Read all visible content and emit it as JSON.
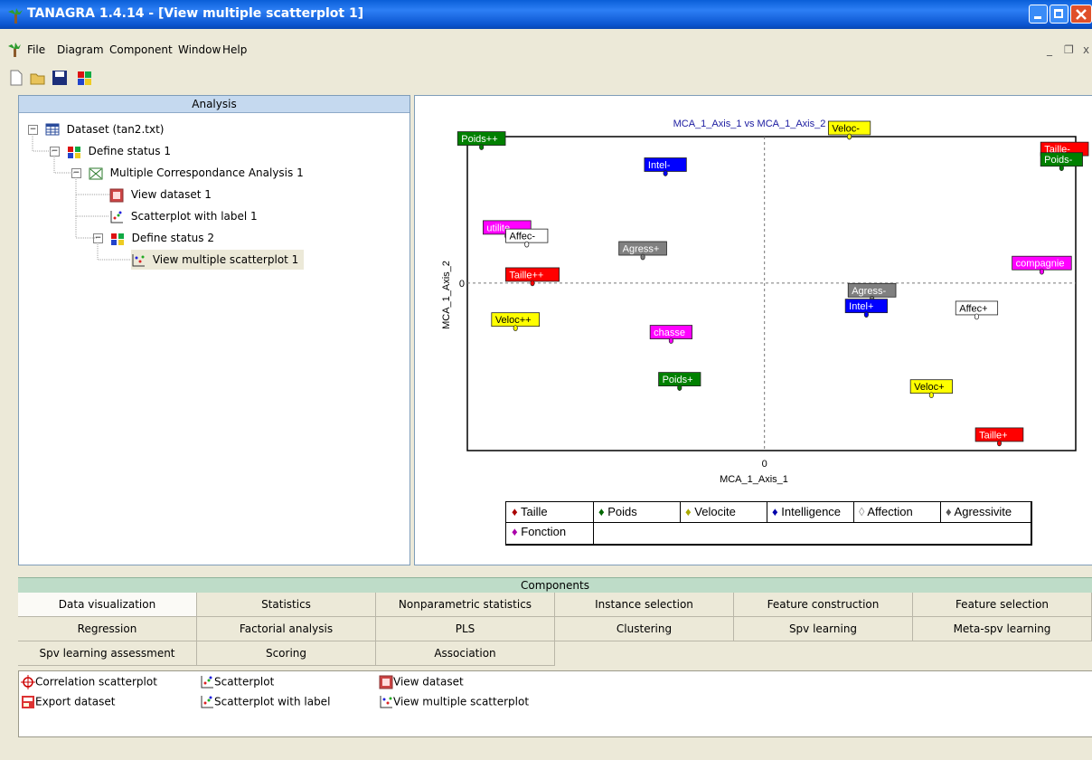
{
  "window": {
    "title": "TANAGRA 1.4.14 - [View multiple scatterplot 1]"
  },
  "menu": {
    "items": [
      "File",
      "Diagram",
      "Component",
      "Window",
      "Help"
    ]
  },
  "analysis": {
    "header": "Analysis",
    "tree": [
      "Dataset (tan2.txt)",
      "Define status 1",
      "Multiple Correspondance Analysis 1",
      "View dataset 1",
      "Scatterplot with label 1",
      "Define status 2",
      "View multiple scatterplot 1"
    ]
  },
  "chart_data": {
    "type": "scatter",
    "title": "MCA_1_Axis_1 vs MCA_1_Axis_2",
    "xlabel": "MCA_1_Axis_1",
    "ylabel": "MCA_1_Axis_2",
    "x_origin_label": "0",
    "y_origin_label": "0",
    "grid": "dashed zero lines",
    "legend_position": "bottom",
    "series": [
      {
        "name": "Taille",
        "color": "#ff0000"
      },
      {
        "name": "Poids",
        "color": "#008000"
      },
      {
        "name": "Velocite",
        "color": "#ffff00"
      },
      {
        "name": "Intelligence",
        "color": "#0000ff"
      },
      {
        "name": "Affection",
        "color": "#ffffff"
      },
      {
        "name": "Agressivite",
        "color": "#808080"
      },
      {
        "name": "Fonction",
        "color": "#ff00ff"
      }
    ],
    "points": [
      {
        "label": "Poids++",
        "series": "Poids",
        "x": -1.0,
        "y": 1.3
      },
      {
        "label": "Veloc-",
        "series": "Velocite",
        "x": 0.3,
        "y": 1.4
      },
      {
        "label": "Taille-",
        "series": "Taille",
        "x": 1.07,
        "y": 1.2
      },
      {
        "label": "Poids-",
        "series": "Poids",
        "x": 1.05,
        "y": 1.1
      },
      {
        "label": "Intel-",
        "series": "Intelligence",
        "x": -0.35,
        "y": 1.05
      },
      {
        "label": "utilite",
        "series": "Fonction",
        "x": -0.91,
        "y": 0.45
      },
      {
        "label": "Affec-",
        "series": "Affection",
        "x": -0.84,
        "y": 0.37
      },
      {
        "label": "Agress+",
        "series": "Agressivite",
        "x": -0.43,
        "y": 0.25
      },
      {
        "label": "compagnie",
        "series": "Fonction",
        "x": 0.98,
        "y": 0.11
      },
      {
        "label": "Taille++",
        "series": "Taille",
        "x": -0.82,
        "y": 0.0
      },
      {
        "label": "Agress-",
        "series": "Agressivite",
        "x": 0.38,
        "y": -0.15
      },
      {
        "label": "Intel+",
        "series": "Intelligence",
        "x": 0.36,
        "y": -0.3
      },
      {
        "label": "Affec+",
        "series": "Affection",
        "x": 0.75,
        "y": -0.32
      },
      {
        "label": "Veloc++",
        "series": "Velocite",
        "x": -0.88,
        "y": -0.43
      },
      {
        "label": "chasse",
        "series": "Fonction",
        "x": -0.33,
        "y": -0.55
      },
      {
        "label": "Poids+",
        "series": "Poids",
        "x": -0.3,
        "y": -1.0
      },
      {
        "label": "Veloc+",
        "series": "Velocite",
        "x": 0.59,
        "y": -1.07
      },
      {
        "label": "Taille+",
        "series": "Taille",
        "x": 0.83,
        "y": -1.53
      }
    ],
    "xlim": [
      -1.05,
      1.1
    ],
    "ylim": [
      -1.6,
      1.4
    ]
  },
  "components": {
    "header": "Components",
    "tabs": [
      [
        "Data visualization",
        "Statistics",
        "Nonparametric statistics",
        "Instance selection",
        "Feature construction",
        "Feature selection"
      ],
      [
        "Regression",
        "Factorial analysis",
        "PLS",
        "Clustering",
        "Spv learning",
        "Meta-spv learning"
      ],
      [
        "Spv learning assessment",
        "Scoring",
        "Association"
      ]
    ],
    "items": [
      {
        "label": "Correlation scatterplot",
        "icon": "crosshair-icon"
      },
      {
        "label": "Scatterplot",
        "icon": "scatter-icon"
      },
      {
        "label": "View dataset",
        "icon": "dataset-icon"
      },
      {
        "label": "Export dataset",
        "icon": "export-icon"
      },
      {
        "label": "Scatterplot with label",
        "icon": "scatter-icon"
      },
      {
        "label": "View multiple scatterplot",
        "icon": "multi-scatter-icon"
      }
    ]
  }
}
